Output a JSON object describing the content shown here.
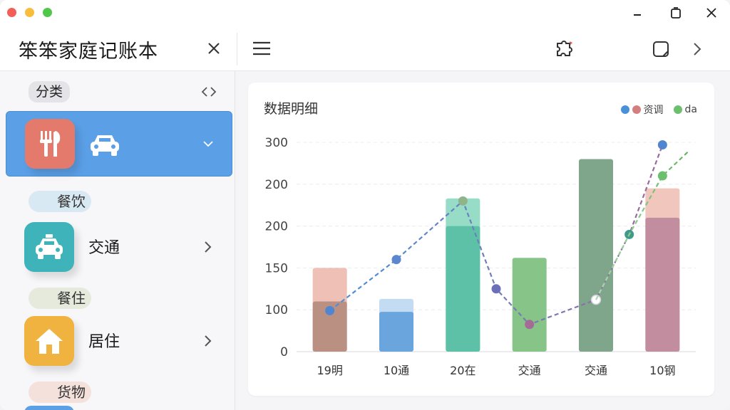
{
  "app": {
    "title": "笨笨家庭记账本"
  },
  "sidebar": {
    "header_label": "分类",
    "items": [
      {
        "label": "",
        "sub_label": "餐饮",
        "active": true,
        "icon": "fork-knife-icon",
        "color": "#e47a6b"
      },
      {
        "label": "交通",
        "sub_label": "餐住",
        "active": false,
        "icon": "car-icon",
        "color": "#3fb3ba"
      },
      {
        "label": "居住",
        "sub_label": "货物",
        "active": false,
        "icon": "house-icon",
        "color": "#f0b33f"
      }
    ]
  },
  "card": {
    "title": "数据明细",
    "legend": [
      {
        "label": "资调",
        "colors": [
          "#4a90d9",
          "#d47f7f"
        ]
      },
      {
        "label": "da",
        "colors": [
          "#6cbf6c"
        ]
      }
    ]
  },
  "chart_data": {
    "type": "bar",
    "title": "数据明细",
    "categories": [
      "19明",
      "10通",
      "20在",
      "交通",
      "交通",
      "10钢"
    ],
    "y_ticks": [
      "0",
      "100",
      "150",
      "200",
      "200",
      "300"
    ],
    "bars": [
      {
        "category": "19明",
        "value": 110,
        "top_value": 150,
        "color": "#b99082",
        "top_color": "#eec0b6"
      },
      {
        "category": "10通",
        "value": 95,
        "top_value": 113,
        "color": "#6aa6dd",
        "top_color": "#c3dbf3"
      },
      {
        "category": "20在",
        "value": 200,
        "top_value": 233,
        "color": "#5cc1a6",
        "top_color": "#96dcc6"
      },
      {
        "category": "交通",
        "value": 162,
        "top_value": null,
        "color": "#87c488",
        "top_color": null
      },
      {
        "category": "交通",
        "value": 280,
        "top_value": null,
        "color": "#7fa58b",
        "top_color": null
      },
      {
        "category": "10钢",
        "value": 210,
        "top_value": 245,
        "color": "#c38da0",
        "top_color": "#f0c6bd"
      }
    ],
    "series": [
      {
        "name": "资调",
        "x": [
          0,
          1,
          2,
          2.5,
          3,
          4,
          4.5,
          5
        ],
        "values": [
          98,
          160,
          230,
          125,
          65,
          112,
          190,
          297
        ],
        "color_from": "#4a90d9",
        "color_to": "#9b6a9b"
      },
      {
        "name": "da",
        "x": [
          4,
          4.5,
          5,
          5.4
        ],
        "values": [
          112,
          190,
          260,
          290
        ],
        "color_from": "#b0d8b0",
        "color_to": "#5eb35e"
      }
    ]
  }
}
